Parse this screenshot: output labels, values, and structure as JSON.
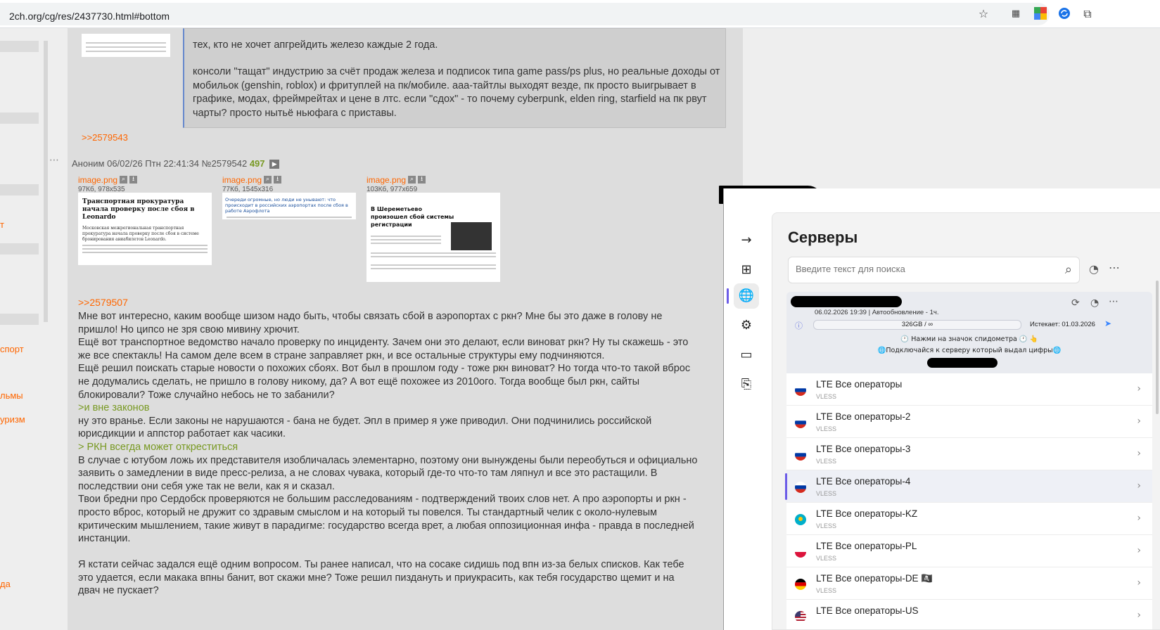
{
  "browser": {
    "url": "2ch.org/cg/res/2437730.html#bottom",
    "icons": [
      "star-icon",
      "qr-icon",
      "translate-icon",
      "sync-icon",
      "extensions-icon"
    ]
  },
  "sidebar": {
    "links": [
      "т",
      "спорт",
      "льмы",
      "уризм",
      "да"
    ]
  },
  "post_top": {
    "text1": "тех, кто не хочет апгрейдить железо каждые 2 года.",
    "text2": "консоли \"тащат\" индустрию за счёт продаж железа и подписок типа game pass/ps plus, но реальные доходы от мобильок (genshin, roblox) и фритуплей на пк/мобиле. ааа-тайтлы выходят везде, пк просто выигрывает в графике, модах, фреймрейтах и цене в лтс. если \"сдох\" - то почему cyberpunk, elden ring, starfield на пк рвут чарты? просто нытьё ньюфага с приставы.",
    "reply_link": ">>2579543"
  },
  "post": {
    "author": "Аноним",
    "datetime": "06/02/26 Птн 22:41:34",
    "number": "№2579542",
    "count": "497",
    "files": [
      {
        "name": "image.png",
        "info": "97Кб, 978x535",
        "headline": "Транспортная прокуратура начала проверку после сбоя в Leonardo",
        "sub": "Московская межрегиональная транспортная прокуратура начала проверку после сбоя в системе бронирования авиабилетов Leonardo."
      },
      {
        "name": "image.png",
        "info": "77Кб, 1545x316",
        "headline": "Очереди огромные, но люди не унывают: что происходит в российских аэропортах после сбоя в работе Аэрофлота"
      },
      {
        "name": "image.png",
        "info": "103Кб, 977x659",
        "headline": "В Шереметьево произошел сбой системы регистрации"
      }
    ],
    "reply_to": ">>2579507",
    "lines": [
      {
        "t": "Мне вот интересно, каким вообще шизом надо быть, чтобы связать сбой в аэропортах с ркн? Мне бы это даже в голову не",
        "q": false
      },
      {
        "t": "пришло! Но ципсо не зря свою мивину хрючит.",
        "q": false
      },
      {
        "t": "Ещё вот транспортное ведомство начало проверку по инциденту. Зачем они это делают, если виноват ркн? Ну ты скажешь - это",
        "q": false
      },
      {
        "t": "же все спектакль! На самом деле всем в стране заправляет ркн, и все остальные структуры ему подчиняются.",
        "q": false
      },
      {
        "t": "Ещё решил поискать старые новости о похожих сбоях. Вот был в прошлом году - тоже ркн виноват? Но тогда что-то такой вброс",
        "q": false
      },
      {
        "t": "не додумались сделать, не пришло в голову никому, да? А вот ещё похожее из 2010ого. Тогда вообще был ркн, сайты",
        "q": false
      },
      {
        "t": "блокировали? Тоже случайно небось не то забанили?",
        "q": false
      },
      {
        "t": ">и вне законов",
        "q": true
      },
      {
        "t": "ну это вранье. Если законы не нарушаются - бана не будет. Эпл в пример я уже приводил. Они подчинились российской",
        "q": false
      },
      {
        "t": "юрисдикции и аппстор работает как часики.",
        "q": false
      },
      {
        "t": "> РКН всегда может откреститься",
        "q": true
      },
      {
        "t": "В случае с ютубом ложь их представителя изобличалась элементарно, поэтому они вынуждены были переобуться и официально",
        "q": false
      },
      {
        "t": "заявить о замедлении в виде пресс-релиза, а не словах чувака, который где-то что-то там ляпнул и все это растащили. В",
        "q": false
      },
      {
        "t": "последствии они себя уже так не вели, как я и сказал.",
        "q": false
      },
      {
        "t": "Твои бредни про Сердобск проверяются не большим расследованиям - подтверждений твоих слов нет. А про аэропорты и ркн -",
        "q": false
      },
      {
        "t": "просто вброс, который не дружит со здравым смыслом и на который ты повелся. Ты стандартный челик с около-нулевым",
        "q": false
      },
      {
        "t": "критическим мышлением, такие живут в парадигме: государство всегда врет, а любая оппозиционная инфа - правда в последней",
        "q": false
      },
      {
        "t": "инстанции.",
        "q": false
      },
      {
        "t": "",
        "q": false
      },
      {
        "t": "Я кстати сейчас задался ещё одним вопросом. Ты ранее написал, что на сосаке сидишь под впн из-за белых списков. Как тебе",
        "q": false
      },
      {
        "t": "это удается, если макака впны банит, вот скажи мне? Тоже решил пиздануть и приукрасить, как тебя государство щемит и на",
        "q": false
      },
      {
        "t": "двач не пускает?",
        "q": false
      }
    ]
  },
  "vpn": {
    "title": "Серверы",
    "search_placeholder": "Введите текст для поиска",
    "sub": {
      "updated": "06.02.2026 19:39 | Автообновление - 1ч.",
      "traffic": "326GB / ∞",
      "expires": "Истекает: 01.03.2026",
      "hint1": "🕐 Нажми на значок спидометра 🕐 👆",
      "hint2": "🌐Подключайся к серверу который выдал цифры🌐"
    },
    "servers": [
      {
        "name": "LTE Все операторы",
        "proto": "VLESS",
        "flag": "ru",
        "active": false
      },
      {
        "name": "LTE  Все операторы-2",
        "proto": "VLESS",
        "flag": "ru",
        "active": false
      },
      {
        "name": "LTE Все операторы-3",
        "proto": "VLESS",
        "flag": "ru",
        "active": false
      },
      {
        "name": "LTE Все операторы-4",
        "proto": "VLESS",
        "flag": "ru",
        "active": true
      },
      {
        "name": "LTE Все операторы-KZ",
        "proto": "VLESS",
        "flag": "kz",
        "active": false
      },
      {
        "name": "LTE Все операторы-PL",
        "proto": "VLESS",
        "flag": "pl",
        "active": false
      },
      {
        "name": "LTE Все операторы-DE 🏴‍☠️",
        "proto": "VLESS",
        "flag": "de",
        "active": false
      },
      {
        "name": "LTE Все операторы-US",
        "proto": "",
        "flag": "us",
        "active": false
      }
    ]
  },
  "colors": {
    "accent": "#6c5ce7",
    "link": "#ff6600",
    "greentext": "#789922"
  }
}
